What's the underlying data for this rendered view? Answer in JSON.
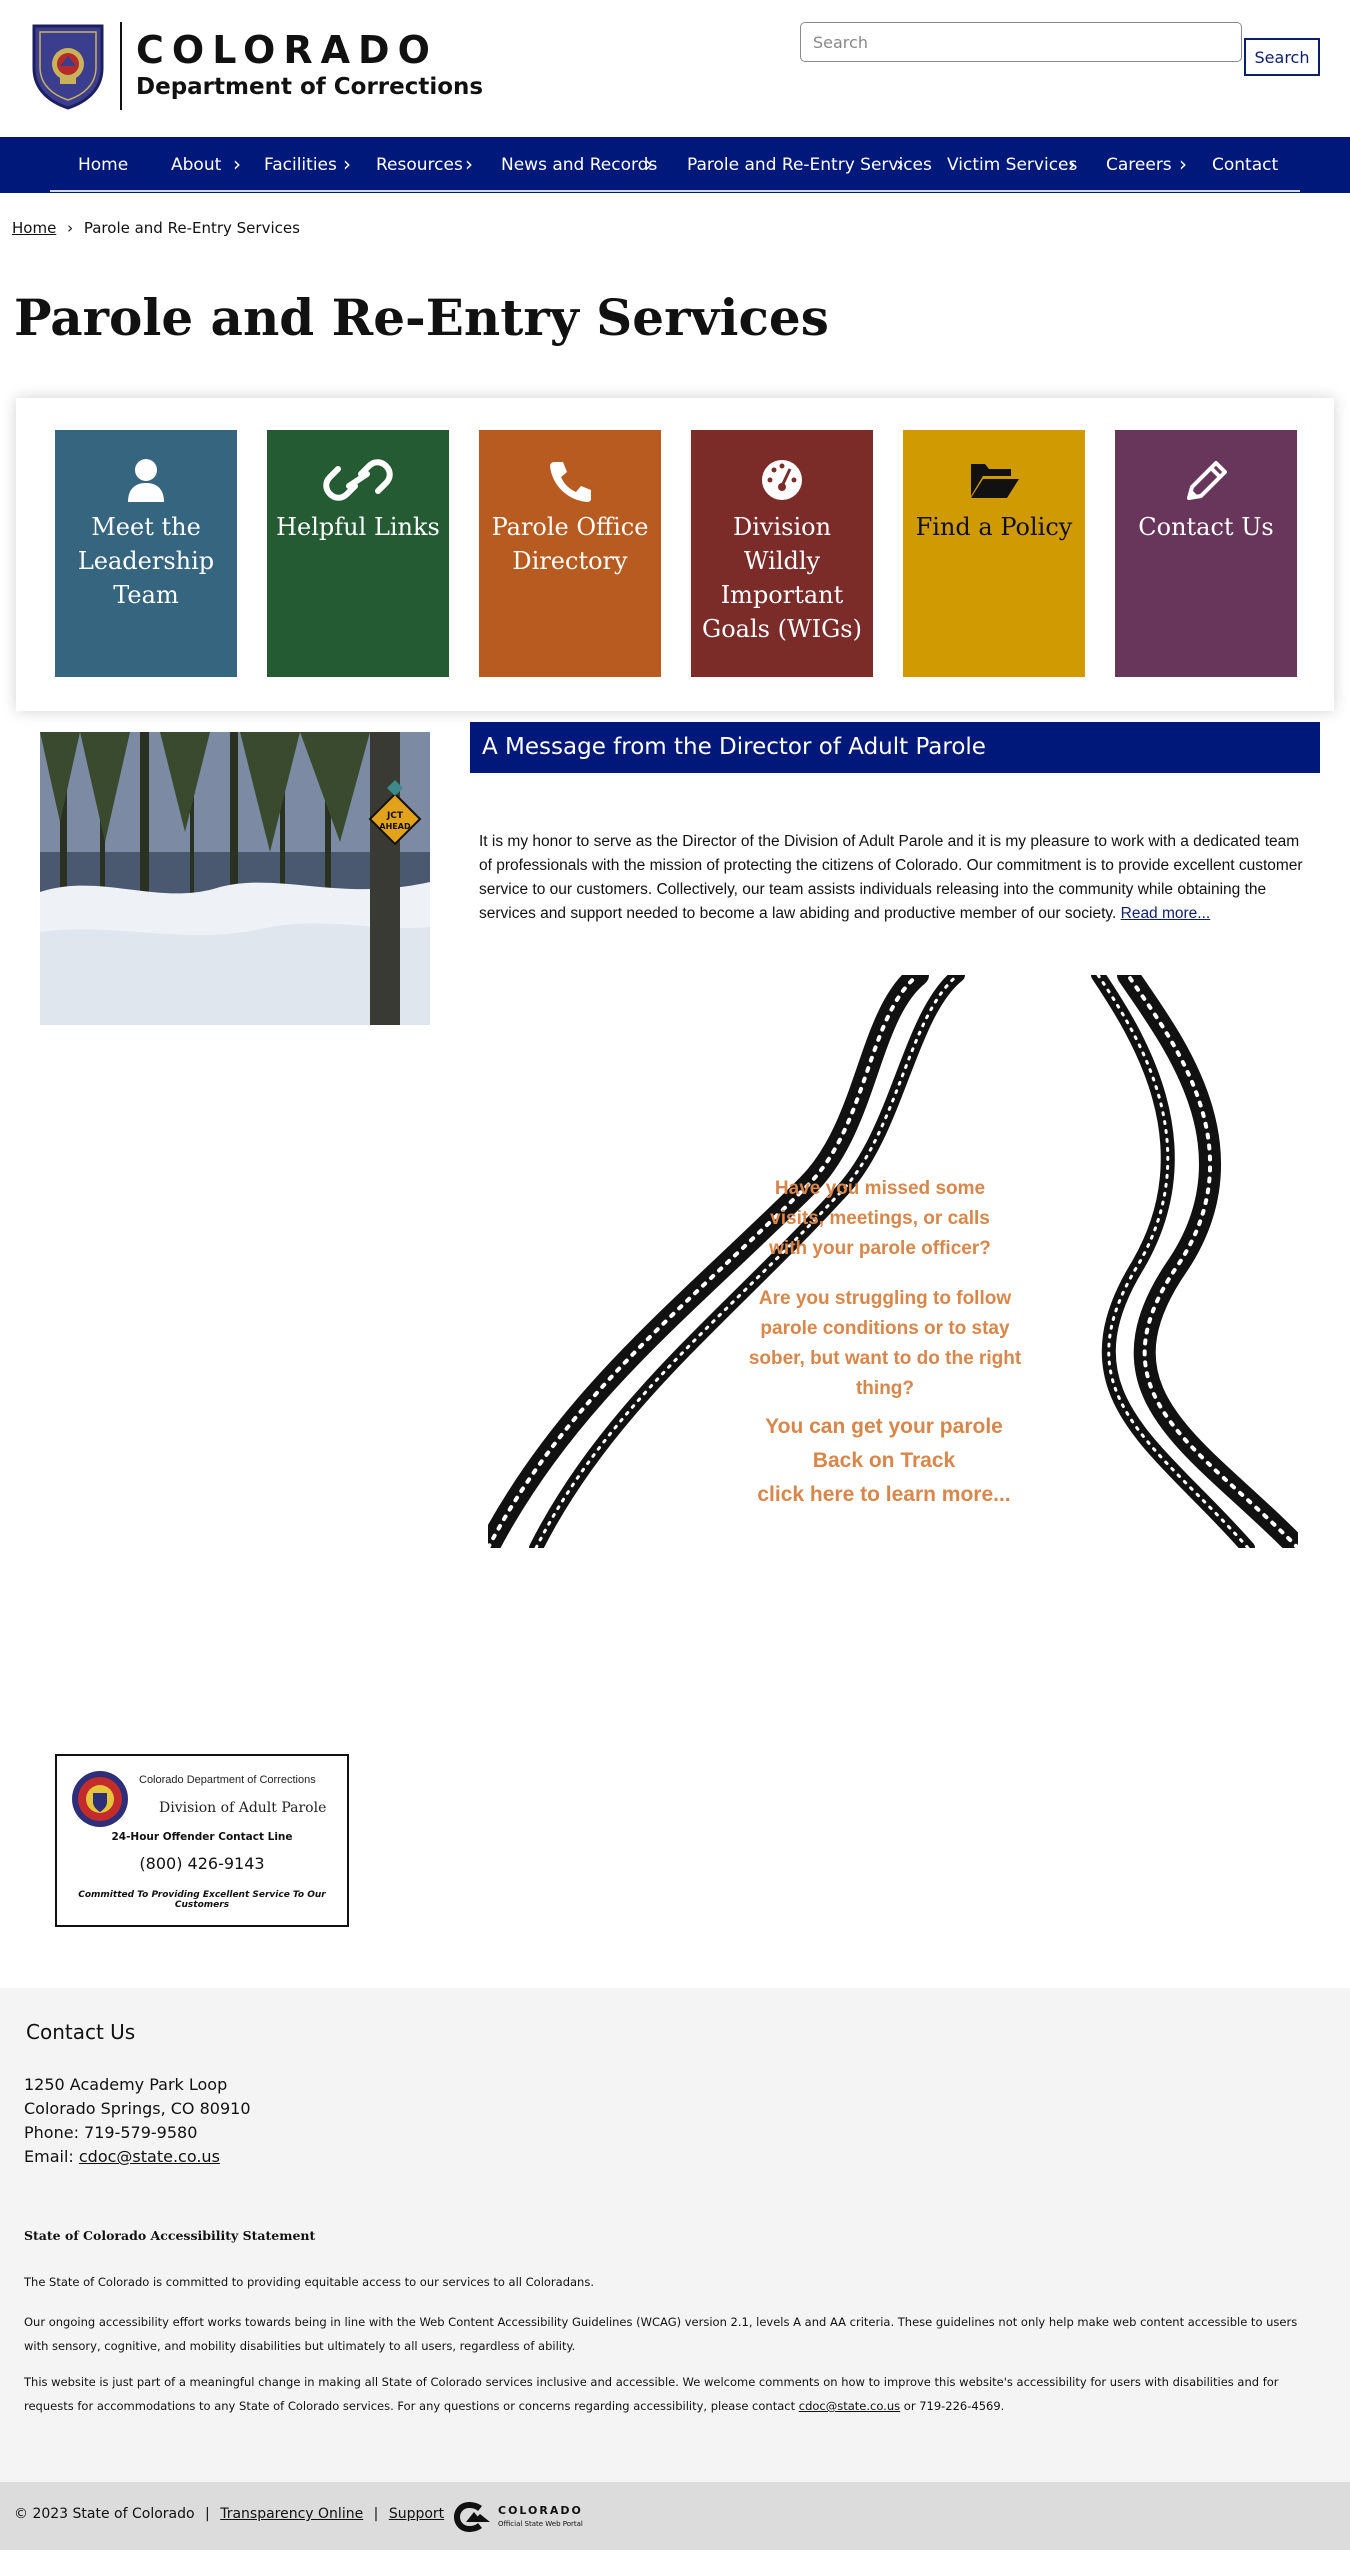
{
  "header": {
    "logo_title": "COLORADO",
    "logo_subtitle": "Department of Corrections",
    "search_placeholder": "Search",
    "search_button": "Search"
  },
  "nav": {
    "items": [
      {
        "label": "Home",
        "has_submenu": false
      },
      {
        "label": "About",
        "has_submenu": true
      },
      {
        "label": "Facilities",
        "has_submenu": true
      },
      {
        "label": "Resources",
        "has_submenu": true
      },
      {
        "label": "News and Records",
        "has_submenu": true
      },
      {
        "label": "Parole and Re-Entry Services",
        "has_submenu": true
      },
      {
        "label": "Victim Services",
        "has_submenu": true
      },
      {
        "label": "Careers",
        "has_submenu": true
      },
      {
        "label": "Contact",
        "has_submenu": false
      }
    ]
  },
  "breadcrumb": {
    "home": "Home",
    "separator": "›",
    "current": "Parole and Re-Entry Services"
  },
  "page_title": "Parole and Re-Entry Services",
  "tiles": [
    {
      "label": "Meet the Leadership Team",
      "icon": "person-icon",
      "color": "#366580"
    },
    {
      "label": "Helpful Links",
      "icon": "link-icon",
      "color": "#255b33"
    },
    {
      "label": "Parole Office Directory",
      "icon": "phone-icon",
      "color": "#b85b21"
    },
    {
      "label": "Division Wildly Important Goals (WIGs)",
      "icon": "dashboard-icon",
      "color": "#7b2b28"
    },
    {
      "label": "Find a Policy",
      "icon": "folder-open-icon",
      "color": "#cf9a02"
    },
    {
      "label": "Contact Us",
      "icon": "pencil-icon",
      "color": "#68365a"
    }
  ],
  "message": {
    "title": "A Message from the Director of Adult Parole",
    "body": "It is my honor to serve as the Director of the Division of Adult Parole and it is my pleasure to work with a dedicated team of professionals with the mission of protecting the citizens of Colorado. Our commitment is to provide excellent customer service to our customers. Collectively, our team assists individuals releasing into the community while obtaining the services and support needed to become a law abiding and productive member of our society.",
    "read_more": "Read more..."
  },
  "photo": {
    "sign_text_1": "JCT",
    "sign_text_2": "AHEAD"
  },
  "promo": {
    "question_1": [
      "Have you missed some",
      "visits, meetings, or calls",
      "with your parole officer?"
    ],
    "question_2": [
      "Are you struggling to follow",
      "parole conditions or to stay",
      "sober, but want to do the right",
      "thing?"
    ],
    "cta": [
      "You can get your parole",
      "Back on Track",
      "click here to learn more..."
    ]
  },
  "contact_card": {
    "org": "Colorado Department of Corrections",
    "division": "Division of Adult Parole",
    "line_label": "24-Hour Offender Contact Line",
    "phone": "(800) 426-9143",
    "motto": "Committed To Providing Excellent Service To Our Customers"
  },
  "footer": {
    "contact_heading": "Contact Us",
    "address_1": "1250 Academy Park Loop",
    "address_2": "Colorado Springs, CO 80910",
    "phone": "Phone: 719-579-9580",
    "email_label": "Email:",
    "email": "cdoc@state.co.us",
    "accessibility_heading": "State of Colorado Accessibility Statement",
    "acc_p1": "The State of Colorado is committed to providing equitable access to our services to all Coloradans.",
    "acc_p2": "Our ongoing accessibility effort works towards being in line with the Web Content Accessibility Guidelines (WCAG) version 2.1, levels A and AA criteria. These guidelines not only help make web content accessible to users with sensory, cognitive, and mobility disabilities but ultimately to all users, regardless of ability.",
    "acc_p3_pre": "This website is just part of a meaningful change in making all State of Colorado services inclusive and accessible. We welcome comments on how to improve this website's accessibility for users with disabilities and for requests for accommodations to any State of Colorado services. For any questions or concerns regarding accessibility, please contact",
    "acc_p3_email": "cdoc@state.co.us",
    "acc_p3_post": "or 719-226-4569."
  },
  "bottom_bar": {
    "copyright": "© 2023 State of Colorado",
    "sep": "|",
    "link_1": "Transparency Online",
    "link_2": "Support",
    "portal_title": "COLORADO",
    "portal_subtitle": "Official State Web Portal"
  }
}
